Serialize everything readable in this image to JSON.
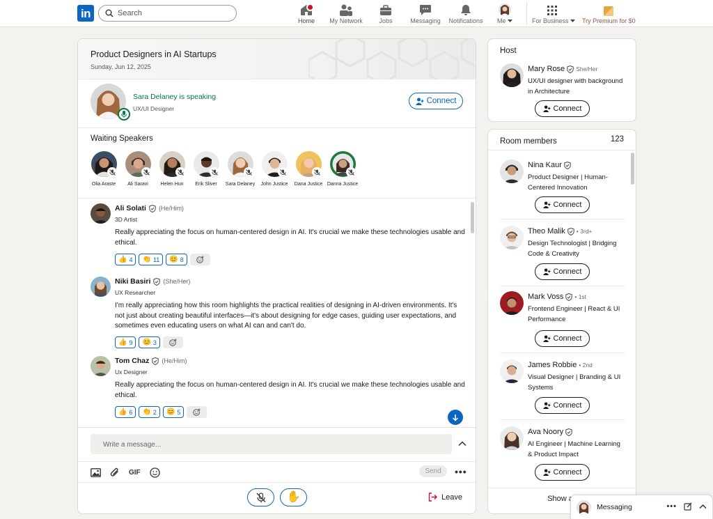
{
  "nav": {
    "logo": "in",
    "search_placeholder": "Search",
    "items": [
      {
        "label": "Home",
        "icon": "home-icon"
      },
      {
        "label": "My Network",
        "icon": "network-icon"
      },
      {
        "label": "Jobs",
        "icon": "briefcase-icon"
      },
      {
        "label": "Messaging",
        "icon": "message-icon"
      },
      {
        "label": "Notifications",
        "icon": "bell-icon"
      },
      {
        "label": "Me",
        "icon": "avatar"
      },
      {
        "label": "For Business",
        "icon": "grid-icon"
      },
      {
        "label": "Try Premium for $0",
        "icon": "premium-icon"
      }
    ]
  },
  "room": {
    "title": "Product Designers in AI Startups",
    "date": "Sunday, Jun 12, 2025"
  },
  "speaker": {
    "status": "Sara Delaney is speaking",
    "role": "UX/UI Designer",
    "connect_label": "Connect"
  },
  "waiting": {
    "title": "Waiting Speakers",
    "people": [
      "Olia Araste",
      "Ali Saravi",
      "Helen Hun",
      "Erik Sliver",
      "Sara Delaney",
      "John Justice",
      "Dana Justice",
      "Danna Justice"
    ]
  },
  "messages": [
    {
      "name": "Ali Solati",
      "pronouns": "(He/Him)",
      "role": "3D Artist",
      "text": "Really appreciating the focus on human-centered design in AI. It's crucial we make these technologies usable and ethical.",
      "reactions": [
        {
          "emoji": "👍",
          "count": "4"
        },
        {
          "emoji": "👏",
          "count": "11"
        },
        {
          "emoji": "😊",
          "count": "8"
        }
      ]
    },
    {
      "name": "Niki Basiri",
      "pronouns": "(She/Her)",
      "role": "UX Researcher",
      "text": "I'm really appreciating how this room highlights the practical realities of designing in AI-driven environments. It's not just about creating beautiful interfaces—it's about designing for edge cases, guiding user expectations, and sometimes even educating users on what AI can and can't do.",
      "reactions": [
        {
          "emoji": "👍",
          "count": "9"
        },
        {
          "emoji": "😊",
          "count": "3"
        }
      ]
    },
    {
      "name": "Tom Chaz",
      "pronouns": "(He/Him)",
      "role": "Ux Designer",
      "text": "Really appreciating the focus on human-centered design in AI. It's crucial we make these technologies usable and ethical.",
      "reactions": [
        {
          "emoji": "👍",
          "count": "6"
        },
        {
          "emoji": "👏",
          "count": "2"
        },
        {
          "emoji": "😊",
          "count": "5"
        }
      ]
    }
  ],
  "compose": {
    "placeholder": "Write a message...",
    "gif_label": "GIF",
    "send_label": "Send",
    "leave_label": "Leave"
  },
  "host": {
    "title": "Host",
    "name": "Mary Rose",
    "pronouns": "She/Her",
    "headline": "UX/UI designer with background in Architecture",
    "connect_label": "Connect"
  },
  "members": {
    "title": "Room members",
    "count": "123",
    "show_all_label": "Show all",
    "list": [
      {
        "name": "Nina Kaur",
        "degree": "",
        "headline": "Product Designer | Human-Centered Innovation",
        "connect_label": "Connect"
      },
      {
        "name": "Theo Malik",
        "degree": "• 3rd+",
        "headline": "Design Technologist | Bridging Code & Creativity",
        "connect_label": "Connect"
      },
      {
        "name": "Mark Voss",
        "degree": "• 1st",
        "headline": "Frontend Engineer | React & UI Performance",
        "connect_label": "Connect"
      },
      {
        "name": "James Robbie",
        "degree": "• 2nd",
        "headline": "Visual Designer | Branding & UI Systems",
        "connect_label": "Connect"
      },
      {
        "name": "Ava Noory",
        "degree": "",
        "headline": "AI Engineer | Machine Learning & Product Impact",
        "connect_label": "Connect"
      }
    ]
  },
  "messaging_bar": {
    "label": "Messaging"
  },
  "colors": {
    "brand": "#0a66c2",
    "speaking": "#057642",
    "notification": "#cb112d",
    "background": "#f4f2ee"
  }
}
